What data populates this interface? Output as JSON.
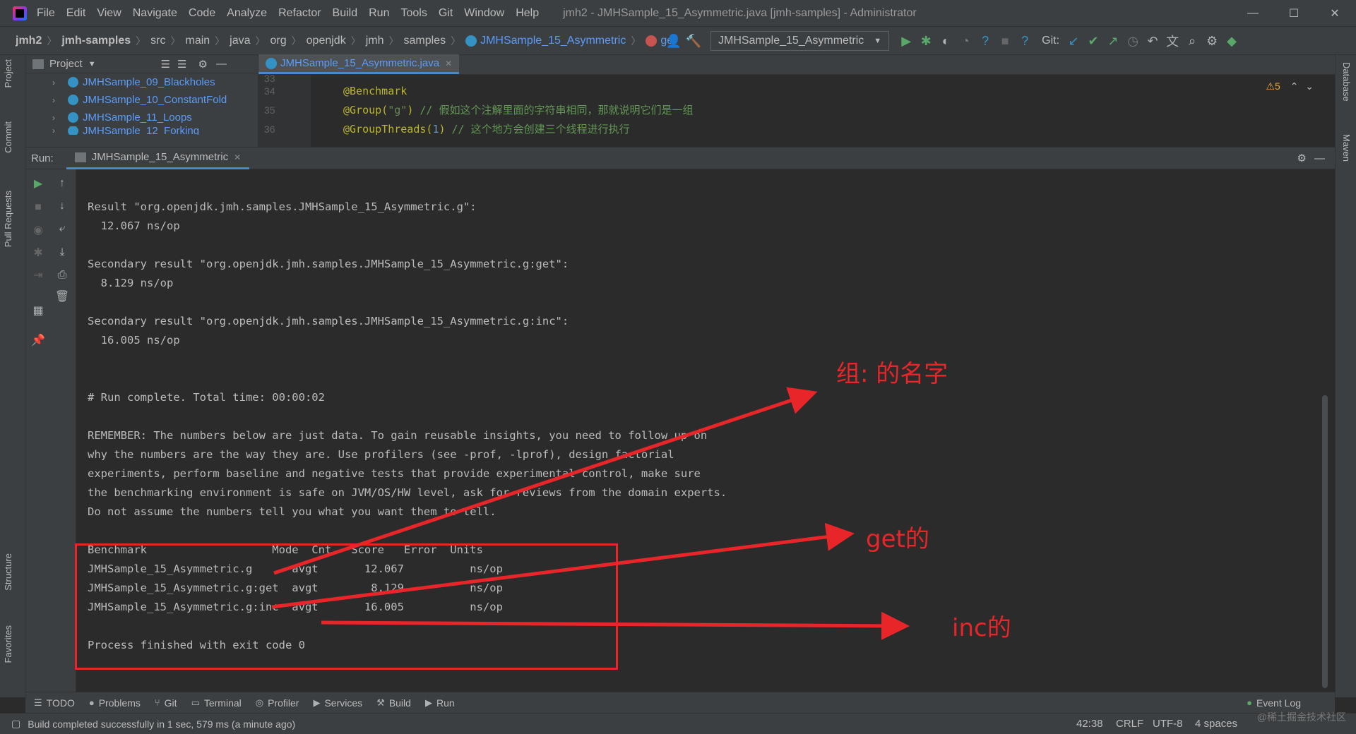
{
  "menubar": {
    "items": [
      "File",
      "Edit",
      "View",
      "Navigate",
      "Code",
      "Analyze",
      "Refactor",
      "Build",
      "Run",
      "Tools",
      "Git",
      "Window",
      "Help"
    ],
    "window_title": "jmh2 - JMHSample_15_Asymmetric.java [jmh-samples] - Administrator",
    "minimize": "—",
    "maximize": "☐",
    "close": "✕"
  },
  "breadcrumb": {
    "items": [
      "jmh2",
      "jmh-samples",
      "src",
      "main",
      "java",
      "org",
      "openjdk",
      "jmh",
      "samples"
    ],
    "class_name": "JMHSample_15_Asymmetric",
    "method_name": "get"
  },
  "toolbar": {
    "run_config": "JMHSample_15_Asymmetric",
    "git_label": "Git:"
  },
  "left_strip": {
    "project": "Project",
    "commit": "Commit",
    "pull_requests": "Pull Requests",
    "structure": "Structure",
    "favorites": "Favorites"
  },
  "right_strip": {
    "database": "Database",
    "maven": "Maven"
  },
  "project_panel": {
    "title": "Project",
    "items": [
      "JMHSample_09_Blackholes",
      "JMHSample_10_ConstantFold",
      "JMHSample_11_Loops",
      "JMHSample_12_Forking"
    ]
  },
  "editor": {
    "tab": "JMHSample_15_Asymmetric.java",
    "line_numbers": [
      "33",
      "34",
      "35",
      "36"
    ],
    "line34": "@Benchmark",
    "line35_ann": "@Group(",
    "line35_str": "\"g\"",
    "line35_close": ") ",
    "line35_cmt": "// 假如这个注解里面的字符串相同，那就说明它们是一组",
    "line36_ann": "@GroupThreads(",
    "line36_num": "1",
    "line36_close": ") ",
    "line36_cmt": "// 这个地方会创建三个线程进行执行",
    "warnings": "⚠5"
  },
  "run_panel": {
    "label": "Run:",
    "tab": "JMHSample_15_Asymmetric"
  },
  "console": {
    "lines": [
      "Result \"org.openjdk.jmh.samples.JMHSample_15_Asymmetric.g\":",
      "  12.067 ns/op",
      "",
      "Secondary result \"org.openjdk.jmh.samples.JMHSample_15_Asymmetric.g:get\":",
      "  8.129 ns/op",
      "",
      "Secondary result \"org.openjdk.jmh.samples.JMHSample_15_Asymmetric.g:inc\":",
      "  16.005 ns/op",
      "",
      "",
      "# Run complete. Total time: 00:00:02",
      "",
      "REMEMBER: The numbers below are just data. To gain reusable insights, you need to follow up on",
      "why the numbers are the way they are. Use profilers (see -prof, -lprof), design factorial",
      "experiments, perform baseline and negative tests that provide experimental control, make sure",
      "the benchmarking environment is safe on JVM/OS/HW level, ask for reviews from the domain experts.",
      "Do not assume the numbers tell you what you want them to tell.",
      "",
      "Benchmark                   Mode  Cnt   Score   Error  Units",
      "JMHSample_15_Asymmetric.g      avgt       12.067          ns/op",
      "JMHSample_15_Asymmetric.g:get  avgt        8.129          ns/op",
      "JMHSample_15_Asymmetric.g:inc  avgt       16.005          ns/op",
      "",
      "Process finished with exit code 0"
    ]
  },
  "annotations": {
    "group_name": "组: 的名字",
    "get_label": "get的",
    "inc_label": "inc的",
    "color": "#e8262a"
  },
  "bottom_tools": {
    "todo": "TODO",
    "problems": "Problems",
    "git": "Git",
    "terminal": "Terminal",
    "profiler": "Profiler",
    "services": "Services",
    "build": "Build",
    "run": "Run",
    "event_log": "Event Log"
  },
  "statusbar": {
    "message": "Build completed successfully in 1 sec, 579 ms (a minute ago)",
    "position": "42:38",
    "line_sep": "CRLF",
    "encoding": "UTF-8",
    "indent": "4 spaces",
    "watermark": "@稀土掘金技术社区"
  }
}
